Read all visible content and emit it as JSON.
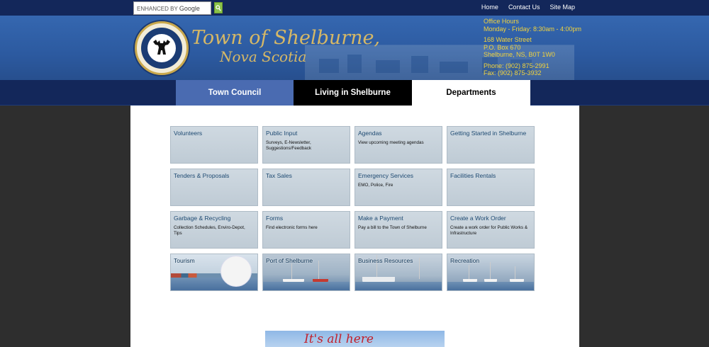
{
  "search": {
    "brand": "ENHANCED BY",
    "provider": "Google"
  },
  "toplinks": [
    "Home",
    "Contact Us",
    "Site Map"
  ],
  "header": {
    "title_line1": "Town of Shelburne,",
    "title_line2": "Nova Scotia",
    "office": {
      "hours_label": "Office Hours",
      "hours": "Monday - Friday: 8:30am - 4:00pm",
      "street": "168 Water Street",
      "pobox": "P.O. Box 670",
      "city": "Shelburne, NS, B0T 1W0",
      "phone": "Phone: (902) 875-2991",
      "fax": "Fax: (902) 875-3932"
    }
  },
  "nav": {
    "tab1": "Town Council",
    "tab2": "Living in Shelburne",
    "tab3": "Departments"
  },
  "tiles": [
    {
      "title": "Volunteers",
      "desc": ""
    },
    {
      "title": "Public Input",
      "desc": "Surveys, E-Newsletter, Suggestions/Feedback"
    },
    {
      "title": "Agendas",
      "desc": "View upcoming meeting agendas"
    },
    {
      "title": "Getting Started in Shelburne",
      "desc": ""
    },
    {
      "title": "Tenders & Proposals",
      "desc": ""
    },
    {
      "title": "Tax Sales",
      "desc": ""
    },
    {
      "title": "Emergency Services",
      "desc": "EMO, Police, Fire"
    },
    {
      "title": "Facilities Rentals",
      "desc": ""
    },
    {
      "title": "Garbage & Recycling",
      "desc": "Collection Schedules, Enviro-Depot, Tips"
    },
    {
      "title": "Forms",
      "desc": "Find electronic forms here"
    },
    {
      "title": "Make a Payment",
      "desc": "Pay a bill to the Town of Shelburne"
    },
    {
      "title": "Create a Work Order",
      "desc": "Create a work order for Public Works & Infrastructure"
    },
    {
      "title": "Tourism",
      "desc": ""
    },
    {
      "title": "Port of Shelburne",
      "desc": ""
    },
    {
      "title": "Business Resources",
      "desc": ""
    },
    {
      "title": "Recreation",
      "desc": ""
    }
  ],
  "banner": {
    "text": "It's all here"
  },
  "colors": {
    "topbar": "#13275a",
    "header": "#2c5aa0",
    "accent_gold": "#f2d33d",
    "tile": "#c7d2db"
  }
}
